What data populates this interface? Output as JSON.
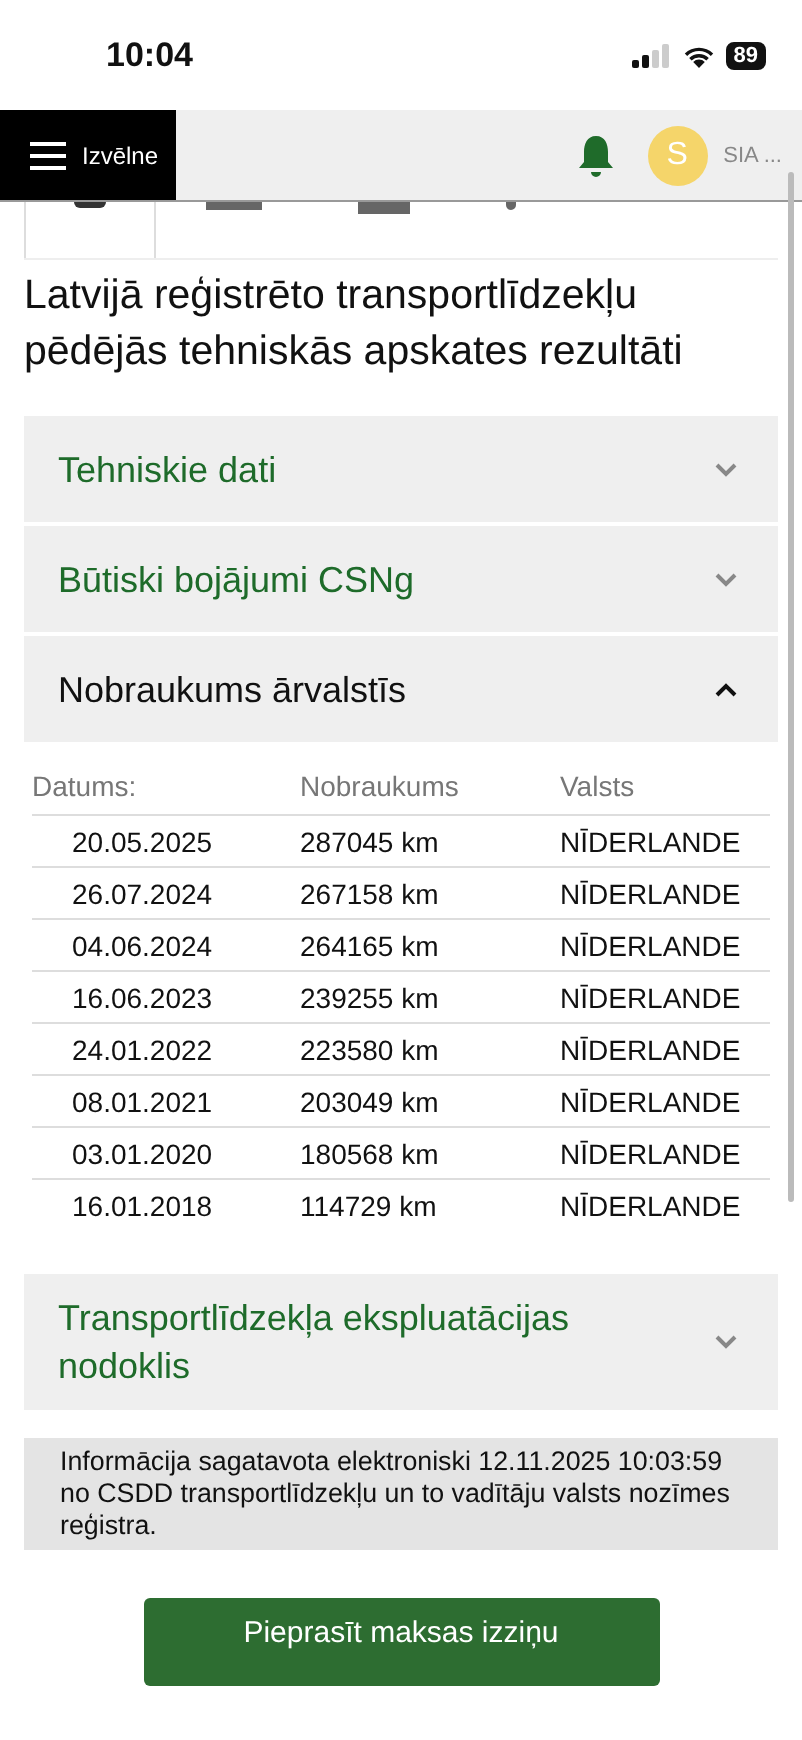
{
  "status_bar": {
    "time": "10:04",
    "battery": "89"
  },
  "header": {
    "menu_label": "Izvēlne",
    "avatar_letter": "S",
    "account": "SIA ..."
  },
  "title": "Latvijā reģistrēto transportlīdzekļu pēdējās tehniskās apskates rezultāti",
  "sections": [
    {
      "label": "Tehniskie dati",
      "expanded": false
    },
    {
      "label": "Būtiski bojājumi CSNg",
      "expanded": false
    },
    {
      "label": "Nobraukums ārvalstīs",
      "expanded": true,
      "table": {
        "columns": [
          "Datums:",
          "Nobraukums",
          "Valsts"
        ],
        "rows": [
          [
            "20.05.2025",
            "287045 km",
            "NĪDERLANDE"
          ],
          [
            "26.07.2024",
            "267158 km",
            "NĪDERLANDE"
          ],
          [
            "04.06.2024",
            "264165 km",
            "NĪDERLANDE"
          ],
          [
            "16.06.2023",
            "239255 km",
            "NĪDERLANDE"
          ],
          [
            "24.01.2022",
            "223580 km",
            "NĪDERLANDE"
          ],
          [
            "08.01.2021",
            "203049 km",
            "NĪDERLANDE"
          ],
          [
            "03.01.2020",
            "180568 km",
            "NĪDERLANDE"
          ],
          [
            "16.01.2018",
            "114729 km",
            "NĪDERLANDE"
          ]
        ]
      }
    },
    {
      "label": "Transportlīdzekļa ekspluatācijas nodoklis",
      "expanded": false
    }
  ],
  "info": "Informācija sagatavota elektroniski 12.11.2025 10:03:59 no CSDD transportlīdzekļu un to vadītāju valsts nozīmes reģistra.",
  "button": "Pieprasīt maksas izziņu"
}
